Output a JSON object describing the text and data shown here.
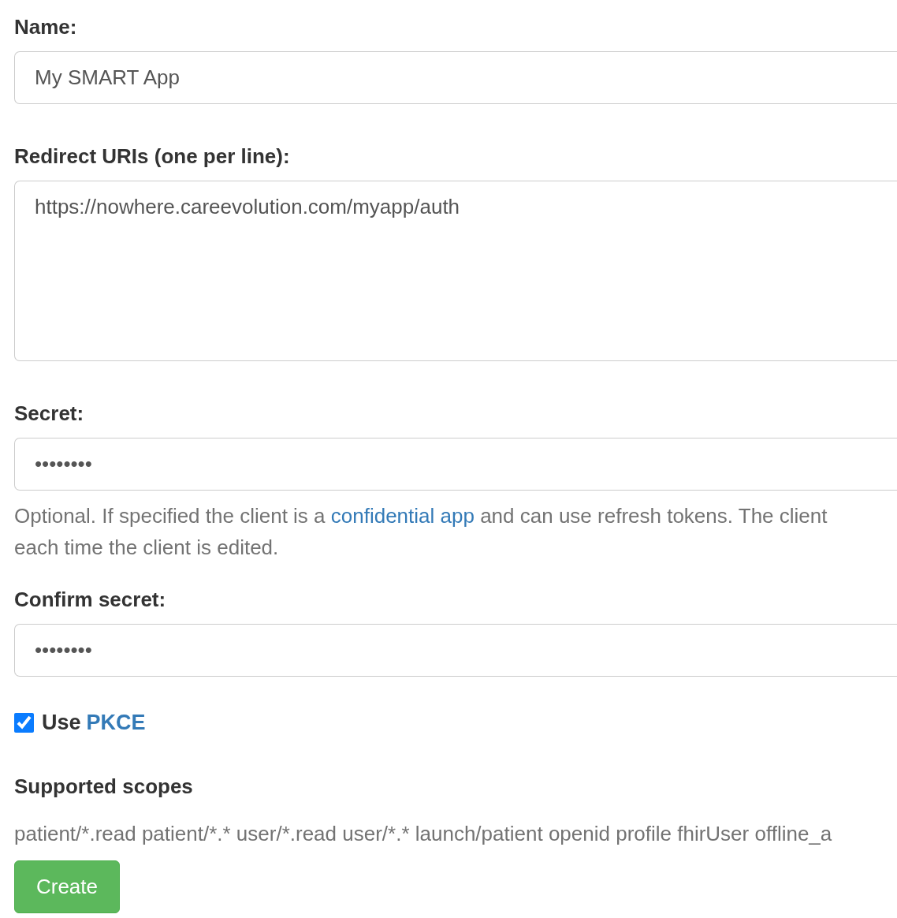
{
  "fields": [
    {
      "kind": "input",
      "label": "Name:",
      "value": "My SMART App"
    },
    {
      "kind": "textarea",
      "label": "Redirect URIs (one per line):",
      "value": "https://nowhere.careevolution.com/myapp/auth"
    },
    {
      "kind": "input",
      "label": "Secret:",
      "value": "••••••••",
      "help": {
        "before": "Optional. If specified the client is a ",
        "link": "confidential app",
        "after": " and can use refresh tokens. The client",
        "continuation": "each time the client is edited."
      }
    },
    {
      "kind": "input",
      "label": "Confirm secret:",
      "value": "••••••••"
    }
  ],
  "pkce": {
    "checked": true,
    "label": "Use",
    "link": "PKCE"
  },
  "scopes": {
    "title": "Supported scopes",
    "text": "patient/*.read patient/*.* user/*.read user/*.* launch/patient openid profile fhirUser offline_a"
  },
  "submit": {
    "label": "Create"
  }
}
